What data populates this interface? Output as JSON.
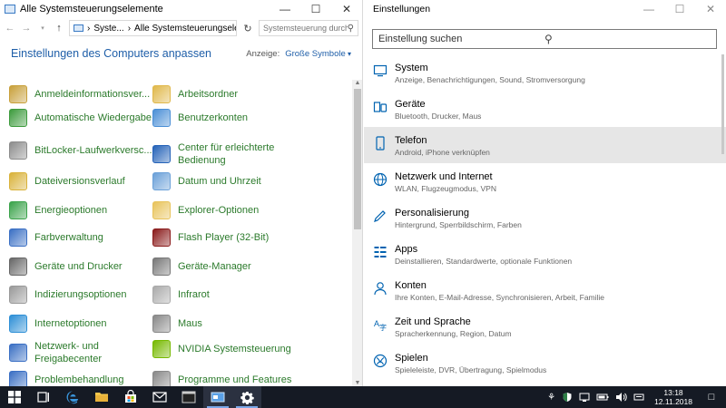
{
  "control_panel": {
    "window_title": "Alle Systemsteuerungselemente",
    "breadcrumb": [
      "Syste...",
      "Alle Systemsteuerungsele..."
    ],
    "search_placeholder": "Systemsteuerung durchsuchen",
    "heading": "Einstellungen des Computers anpassen",
    "view_label": "Anzeige:",
    "view_value": "Große Symbole",
    "items": [
      {
        "label": "Anmeldeinformationsver...",
        "icon": "credential-manager-icon",
        "color": "#c8a03a"
      },
      {
        "label": "Arbeitsordner",
        "icon": "work-folders-icon",
        "color": "#e0b84a"
      },
      {
        "label": "Automatische Wiedergabe",
        "icon": "autoplay-icon",
        "color": "#3d9b3d"
      },
      {
        "label": "Benutzerkonten",
        "icon": "user-accounts-icon",
        "color": "#4a8fd6"
      },
      {
        "label": "BitLocker-Laufwerkversc...",
        "icon": "bitlocker-icon",
        "color": "#8c8c8c"
      },
      {
        "label": "Center für erleichterte Bedienung",
        "icon": "ease-of-access-icon",
        "color": "#2462b8"
      },
      {
        "label": "Dateiversionsverlauf",
        "icon": "file-history-icon",
        "color": "#d9b23a"
      },
      {
        "label": "Datum und Uhrzeit",
        "icon": "date-time-icon",
        "color": "#6aa0d8"
      },
      {
        "label": "Energieoptionen",
        "icon": "power-options-icon",
        "color": "#3aa34a"
      },
      {
        "label": "Explorer-Optionen",
        "icon": "explorer-options-icon",
        "color": "#e8c35a"
      },
      {
        "label": "Farbverwaltung",
        "icon": "color-management-icon",
        "color": "#3a6fc4"
      },
      {
        "label": "Flash Player (32-Bit)",
        "icon": "flash-player-icon",
        "color": "#8a1a1a"
      },
      {
        "label": "Geräte und Drucker",
        "icon": "devices-printers-icon",
        "color": "#666666"
      },
      {
        "label": "Geräte-Manager",
        "icon": "device-manager-icon",
        "color": "#777777"
      },
      {
        "label": "Indizierungsoptionen",
        "icon": "indexing-options-icon",
        "color": "#999999"
      },
      {
        "label": "Infrarot",
        "icon": "infrared-icon",
        "color": "#aaaaaa"
      },
      {
        "label": "Internetoptionen",
        "icon": "internet-options-icon",
        "color": "#2d8fd6"
      },
      {
        "label": "Maus",
        "icon": "mouse-icon",
        "color": "#888888"
      },
      {
        "label": "Netzwerk- und Freigabecenter",
        "icon": "network-sharing-icon",
        "color": "#3a6fc4"
      },
      {
        "label": "NVIDIA Systemsteuerung",
        "icon": "nvidia-icon",
        "color": "#76b900"
      },
      {
        "label": "Problembehandlung",
        "icon": "troubleshooting-icon",
        "color": "#3a6fc4"
      },
      {
        "label": "Programme und Features",
        "icon": "programs-features-icon",
        "color": "#888888"
      }
    ]
  },
  "settings": {
    "window_title": "Einstellungen",
    "search_placeholder": "Einstellung suchen",
    "accent_color": "#0063b1",
    "categories": [
      {
        "name": "System",
        "desc": "Anzeige, Benachrichtigungen, Sound, Stromversorgung",
        "icon": "system-icon",
        "active": false
      },
      {
        "name": "Geräte",
        "desc": "Bluetooth, Drucker, Maus",
        "icon": "devices-icon",
        "active": false
      },
      {
        "name": "Telefon",
        "desc": "Android, iPhone verknüpfen",
        "icon": "phone-icon",
        "active": true
      },
      {
        "name": "Netzwerk und Internet",
        "desc": "WLAN, Flugzeugmodus, VPN",
        "icon": "globe-icon",
        "active": false
      },
      {
        "name": "Personalisierung",
        "desc": "Hintergrund, Sperrbildschirm, Farben",
        "icon": "personalization-icon",
        "active": false
      },
      {
        "name": "Apps",
        "desc": "Deinstallieren, Standardwerte, optionale Funktionen",
        "icon": "apps-icon",
        "active": false
      },
      {
        "name": "Konten",
        "desc": "Ihre Konten, E-Mail-Adresse, Synchronisieren, Arbeit, Familie",
        "icon": "accounts-icon",
        "active": false
      },
      {
        "name": "Zeit und Sprache",
        "desc": "Spracherkennung, Region, Datum",
        "icon": "time-language-icon",
        "active": false
      },
      {
        "name": "Spielen",
        "desc": "Spieleleiste, DVR, Übertragung, Spielmodus",
        "icon": "gaming-icon",
        "active": false
      }
    ]
  },
  "taskbar": {
    "time": "13:18",
    "date": "12.11.2018"
  }
}
